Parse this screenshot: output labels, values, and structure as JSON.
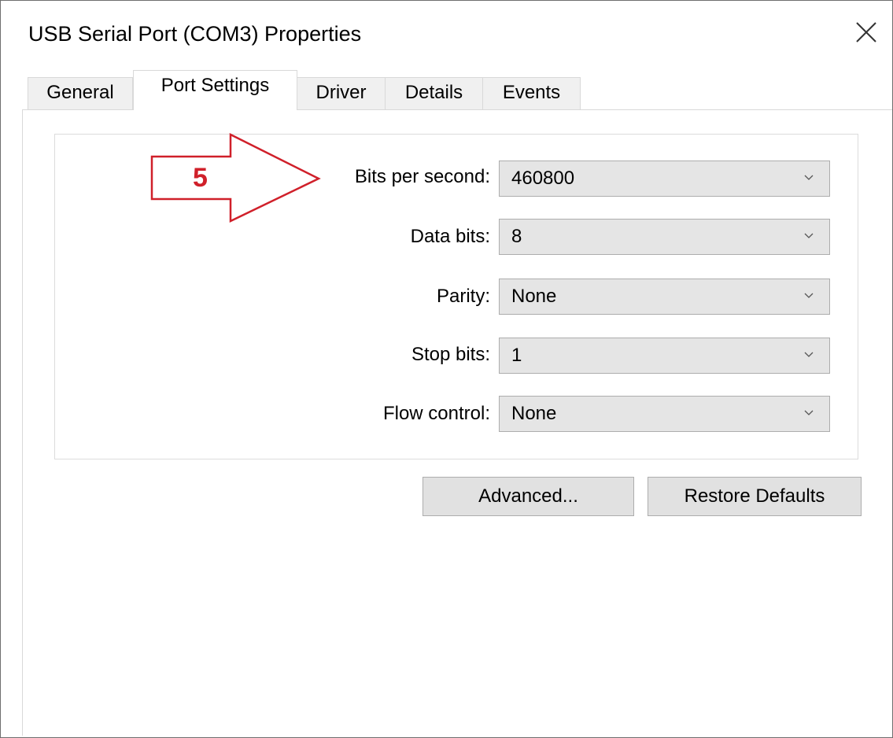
{
  "window": {
    "title": "USB Serial Port (COM3) Properties",
    "close_icon": "close-icon"
  },
  "tabs": [
    {
      "label": "General",
      "active": false
    },
    {
      "label": "Port Settings",
      "active": true
    },
    {
      "label": "Driver",
      "active": false
    },
    {
      "label": "Details",
      "active": false
    },
    {
      "label": "Events",
      "active": false
    }
  ],
  "port_settings": {
    "fields": [
      {
        "label": "Bits per second:",
        "value": "460800"
      },
      {
        "label": "Data bits:",
        "value": "8"
      },
      {
        "label": "Parity:",
        "value": "None"
      },
      {
        "label": "Stop bits:",
        "value": "1"
      },
      {
        "label": "Flow control:",
        "value": "None"
      }
    ]
  },
  "buttons": {
    "advanced": "Advanced...",
    "restore_defaults": "Restore Defaults"
  },
  "annotation": {
    "number": "5",
    "color": "#d0202a",
    "icon": "arrow-right-icon"
  }
}
